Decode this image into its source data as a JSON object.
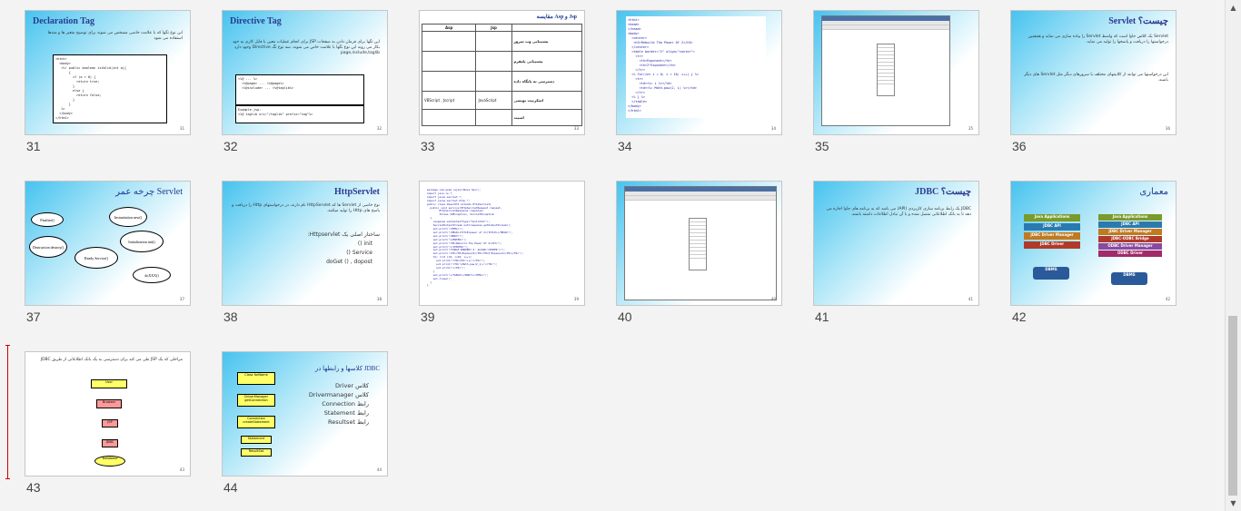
{
  "slides": [
    {
      "num": "31",
      "title": "Declaration Tag",
      "body": "این نوع تگها که با علامت خاصی مشخص می شوند برای توضیح متغیر ها و متدها استفاده می شود",
      "page": "31"
    },
    {
      "num": "32",
      "title": "Directive Tag",
      "body": "این تگها برای فرمان دادن به صفحات JSP برای انجام عملیات معین با فایل کاری به خود بکار می روند این نوع تگها با علامت خاص می شوند. سه نوع تگ Directive وجود دارد page,include,taglib",
      "page": "32"
    },
    {
      "num": "33",
      "title": "مقایسه Asp و Jsp",
      "page": "33"
    },
    {
      "num": "34",
      "title": "",
      "page": "34"
    },
    {
      "num": "35",
      "title": "",
      "page": "35"
    },
    {
      "num": "36",
      "title": "Servlet چیست؟",
      "body": "Servlet یک کلاس جاوا است که واسط Servlet را پیاده سازی می نماید و همچنین درخواستها را دریافت و پاسخها را تولید می نماید.",
      "body2": "این درخواستها می توانند از کلاینتهای مختلف یا سرورهای دیگر مثل Servlet های دیگر باشند.",
      "page": "36"
    },
    {
      "num": "37",
      "title": "چرخه عمر Servlet",
      "labels": [
        "Finalize()",
        "Instantiation new()",
        "Initialization init()",
        "Ready Service()",
        "Destruction destroy()",
        "doXXX()"
      ],
      "page": "37"
    },
    {
      "num": "38",
      "title": "HttpServlet",
      "body": "نوع خاصی از Servlet ها که HttpServlet نام دارند، در درخواستهای Http را دریافت و پاسخ های Http را تولید میکنند.",
      "body2": "ساختار اصلی یک Httpservlet:",
      "items": [
        "init ()",
        "Service ()",
        "doGet () , dopost"
      ],
      "page": "38"
    },
    {
      "num": "39",
      "title": "",
      "page": "39"
    },
    {
      "num": "40",
      "title": "",
      "page": "40"
    },
    {
      "num": "41",
      "title": "JDBC چیست؟",
      "body": "JDBC یک رابط برنامه سازی کاربردی (API) می باشد که به برنامه های جاوا اجازه می دهد تا به بانک اطلاعاتی متصل شده و با آن تبادل اطلاعات داشته باشند.",
      "page": "41"
    },
    {
      "num": "42",
      "title": "معماری",
      "arch_left": [
        "Java Applications",
        "JDBC API",
        "JDBC Driver Manager",
        "JDBC Driver",
        "DBMS"
      ],
      "arch_right": [
        "Java Applications",
        "JDBC API",
        "JDBC Driver Manager",
        "JDBC-ODBC Bridge",
        "ODBC Driver Manager",
        "ODBC Driver",
        "DBMS"
      ],
      "page": "42"
    },
    {
      "num": "43",
      "title": "",
      "body": "مراحلی که یک JSP طی می کند برای دسترسی به یک بانک اطلاعاتی از طریق JDBC",
      "boxes": [
        "User",
        "Browser",
        "JSP",
        "JDBC",
        "Database"
      ],
      "page": "43"
    },
    {
      "num": "44",
      "title": "کلاسها و رابطها در JDBC",
      "items": [
        "کلاس Driver",
        "کلاس Drivermanager",
        "رابط Connection",
        "رابط Statement",
        "رابط Resultset"
      ],
      "boxes": [
        "Class forName",
        "DriverManager getConnection",
        "Connection createStatement",
        "Statement",
        "ResultSet"
      ],
      "page": "44"
    }
  ],
  "code34": "<html>\n<head>\n</head>\n<body>\n  <center>\n   <h3>Rebuild The Power Of 2</h3>\n  </center>\n  <table border=\"2\" align=\"center\">\n    <tr>\n      <th>Exponent</th>\n      <th>2^Exponent</th>\n    </tr>\n  <% for(int i = 0; i < 10; i++) { %>\n    <tr>\n      <td><%= i %></td>\n      <td><%= Math.pow(2, i) %></td>\n    </tr>\n  <% } %>\n  </table>\n</body>\n</html>",
  "code39": "package com.exam (ejoul/Nova hour);\nimport java.io.*;\nimport javax.servlet.*;\nimport javax.servlet.http.*;\npublic class PowerOf2 extends HttpServlet{\n  public void service(HttpServletRequest request,\n        HttpServletResponse response)\n        throws IOException, ServletException\n  {\n    response.setContentType(\"text/html\");\n    ServletOutputStream out=response.getOutputStream();\n    out.print(\"<HTML>\");\n    out.print(\"<HEAD><TITLE>power of 2</TITLE></HEAD>\");\n    out.print(\"<BODY>\");\n    out.print(\"<CENTER>\");\n    out.print(\"<H3>Rebuild The Power Of 2</H3>\");\n    out.print(\"</CENTER>\");\n    out.print(\"<TABLE BORDER='2' ALIGN='CENTER'>\");\n    out.print(\"<TR><TH>Exponent</TH><TH>2^Exponent</TH></TR>\");\n    for (int i=0; i<10; i++){\n      out.print(\"<TR><TD>\"+i+\"</TD>\");\n      out.print(\"<TD>\"+Math.pow(2,i)+\"</TD>\");\n      out.print(\"</TR>\");\n    }\n    out.print(\"</TABLE></BODY></HTML>\");\n    out.close();\n  }\n}",
  "table33": {
    "headers": [
      "Asp",
      "Jsp",
      ""
    ],
    "rows": [
      [
        "",
        "",
        "پشتیبانی وب سرور"
      ],
      [
        "",
        "",
        "پشتیبانی پلتفرم"
      ],
      [
        "",
        "",
        "دسترسی به پایگاه داده"
      ],
      [
        "VBScript , Jscript",
        "JavaScript",
        "اسکریپت نویسی"
      ],
      [
        "",
        "",
        "امنیت"
      ]
    ]
  },
  "scroll": {
    "up": "▲",
    "down": "▼"
  }
}
